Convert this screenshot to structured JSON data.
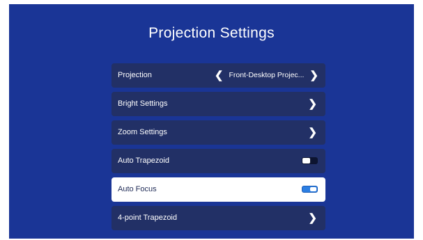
{
  "title": "Projection Settings",
  "menu": {
    "projection": {
      "label": "Projection",
      "value": "Front-Desktop Projec..."
    },
    "bright": {
      "label": "Bright Settings"
    },
    "zoom": {
      "label": "Zoom Settings"
    },
    "auto_trapezoid": {
      "label": "Auto Trapezoid",
      "enabled": false
    },
    "auto_focus": {
      "label": "Auto Focus",
      "enabled": true,
      "selected": true
    },
    "four_point": {
      "label": "4-point Trapezoid"
    }
  },
  "icons": {
    "left": "chevron-left-icon",
    "right": "chevron-right-icon"
  },
  "colors": {
    "background": "#1a3596",
    "row": "#223066",
    "selected_row": "#ffffff",
    "toggle_on": "#2c7fe3"
  }
}
